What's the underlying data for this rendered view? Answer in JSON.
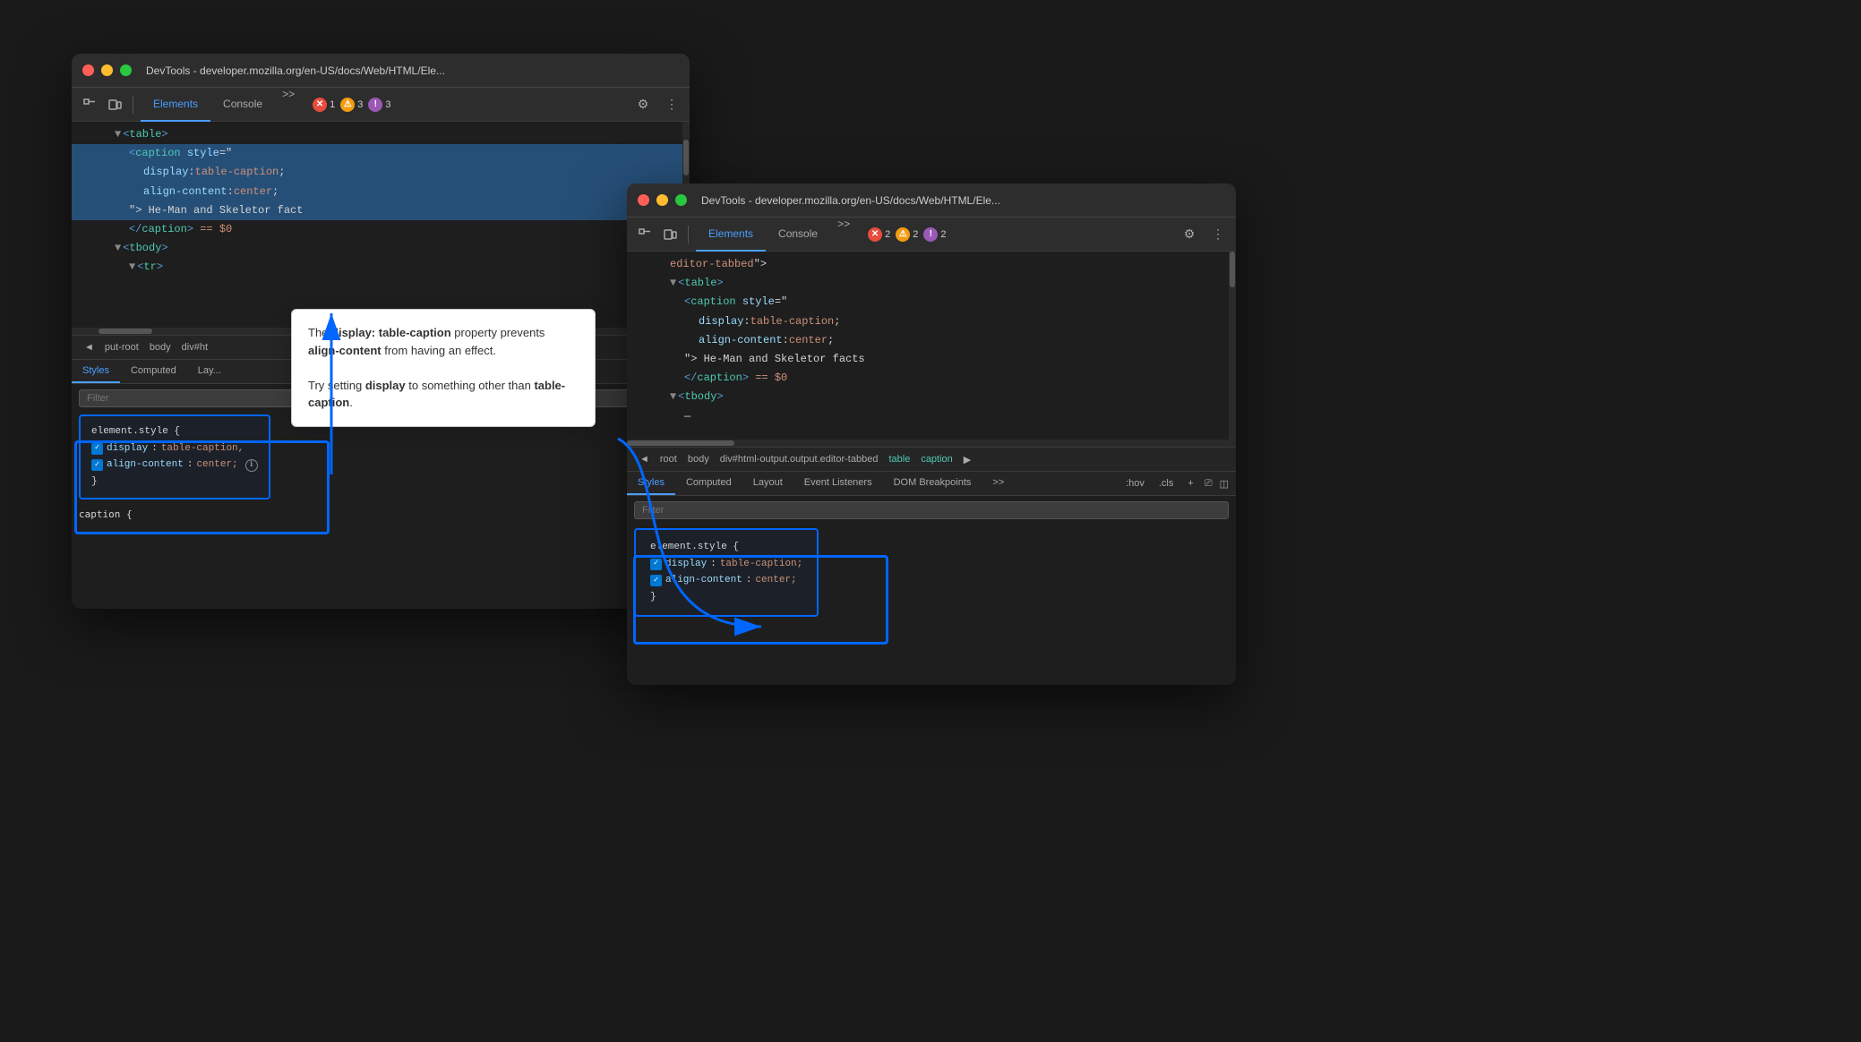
{
  "window1": {
    "title": "DevTools - developer.mozilla.org/en-US/docs/Web/HTML/Ele...",
    "tabs": [
      "Elements",
      "Console"
    ],
    "active_tab": "Elements",
    "badges": [
      {
        "color": "red",
        "count": "1"
      },
      {
        "color": "yellow",
        "count": "3"
      },
      {
        "color": "purple",
        "count": "3"
      }
    ],
    "html_lines": [
      {
        "indent": 8,
        "content": "▼<table>",
        "selected": false
      },
      {
        "indent": 12,
        "content": "<caption style=\"",
        "selected": true
      },
      {
        "indent": 16,
        "content": "display: table-caption;",
        "selected": true
      },
      {
        "indent": 16,
        "content": "align-content: center;",
        "selected": true
      },
      {
        "indent": 12,
        "content": "\"> He-Man and Skeletor facts",
        "selected": true,
        "partial": true
      },
      {
        "indent": 12,
        "content": "</caption> == $0",
        "selected": false
      },
      {
        "indent": 8,
        "content": "▼<tbody>",
        "selected": false
      },
      {
        "indent": 12,
        "content": "▼<tr>",
        "selected": false
      }
    ],
    "breadcrumb": [
      "◄",
      "put-root",
      "body",
      "div#ht"
    ],
    "bottom_tabs": [
      "Styles",
      "Computed",
      "Lay..."
    ],
    "active_bottom_tab": "Styles",
    "filter_placeholder": "Filter",
    "css_block": {
      "selector": "element.style {",
      "props": [
        {
          "prop": "display",
          "val": "table-caption,"
        },
        {
          "prop": "align-content",
          "val": "center;"
        }
      ],
      "close": "}"
    },
    "below_text": "caption {"
  },
  "window2": {
    "title": "DevTools - developer.mozilla.org/en-US/docs/Web/HTML/Ele...",
    "tabs": [
      "Elements",
      "Console"
    ],
    "active_tab": "Elements",
    "badges": [
      {
        "color": "red",
        "count": "2"
      },
      {
        "color": "yellow",
        "count": "2"
      },
      {
        "color": "purple",
        "count": "2"
      }
    ],
    "html_lines": [
      {
        "indent": 8,
        "content": "editor-tabbed\">",
        "selected": false
      },
      {
        "indent": 8,
        "content": "▼<table>",
        "selected": false
      },
      {
        "indent": 12,
        "content": "<caption style=\"",
        "selected": false
      },
      {
        "indent": 16,
        "content": "display: table-caption;",
        "selected": false
      },
      {
        "indent": 16,
        "content": "align-content: center;",
        "selected": false
      },
      {
        "indent": 12,
        "content": "\"> He-Man and Skeletor facts",
        "selected": false
      },
      {
        "indent": 12,
        "content": "</caption> == $0",
        "selected": false
      },
      {
        "indent": 8,
        "content": "▼<tbody>",
        "selected": false
      },
      {
        "indent": 8,
        "content": "—",
        "selected": false
      }
    ],
    "breadcrumb": [
      "◄",
      "root",
      "body",
      "div#html-output.output.editor-tabbed",
      "table",
      "caption"
    ],
    "bottom_tabs": [
      "Styles",
      "Computed",
      "Layout",
      "Event Listeners",
      "DOM Breakpoints",
      ">>"
    ],
    "active_bottom_tab": "Styles",
    "filter_placeholder": "Filter",
    "toolbar_right": [
      ":hov",
      ".cls",
      "+",
      "⎚",
      "◫"
    ],
    "css_block": {
      "selector": "element.style {",
      "props": [
        {
          "prop": "display",
          "val": "table-caption;"
        },
        {
          "prop": "align-content",
          "val": "center;"
        }
      ],
      "close": "}"
    }
  },
  "tooltip": {
    "text_parts": [
      "The ",
      "display: table-caption",
      " property prevents ",
      "align-content",
      " from having an effect.",
      "\n\nTry setting ",
      "display",
      " to something other than ",
      "table-caption",
      "."
    ]
  },
  "arrow": {
    "from": "left panel css block",
    "to": "right panel css block"
  }
}
